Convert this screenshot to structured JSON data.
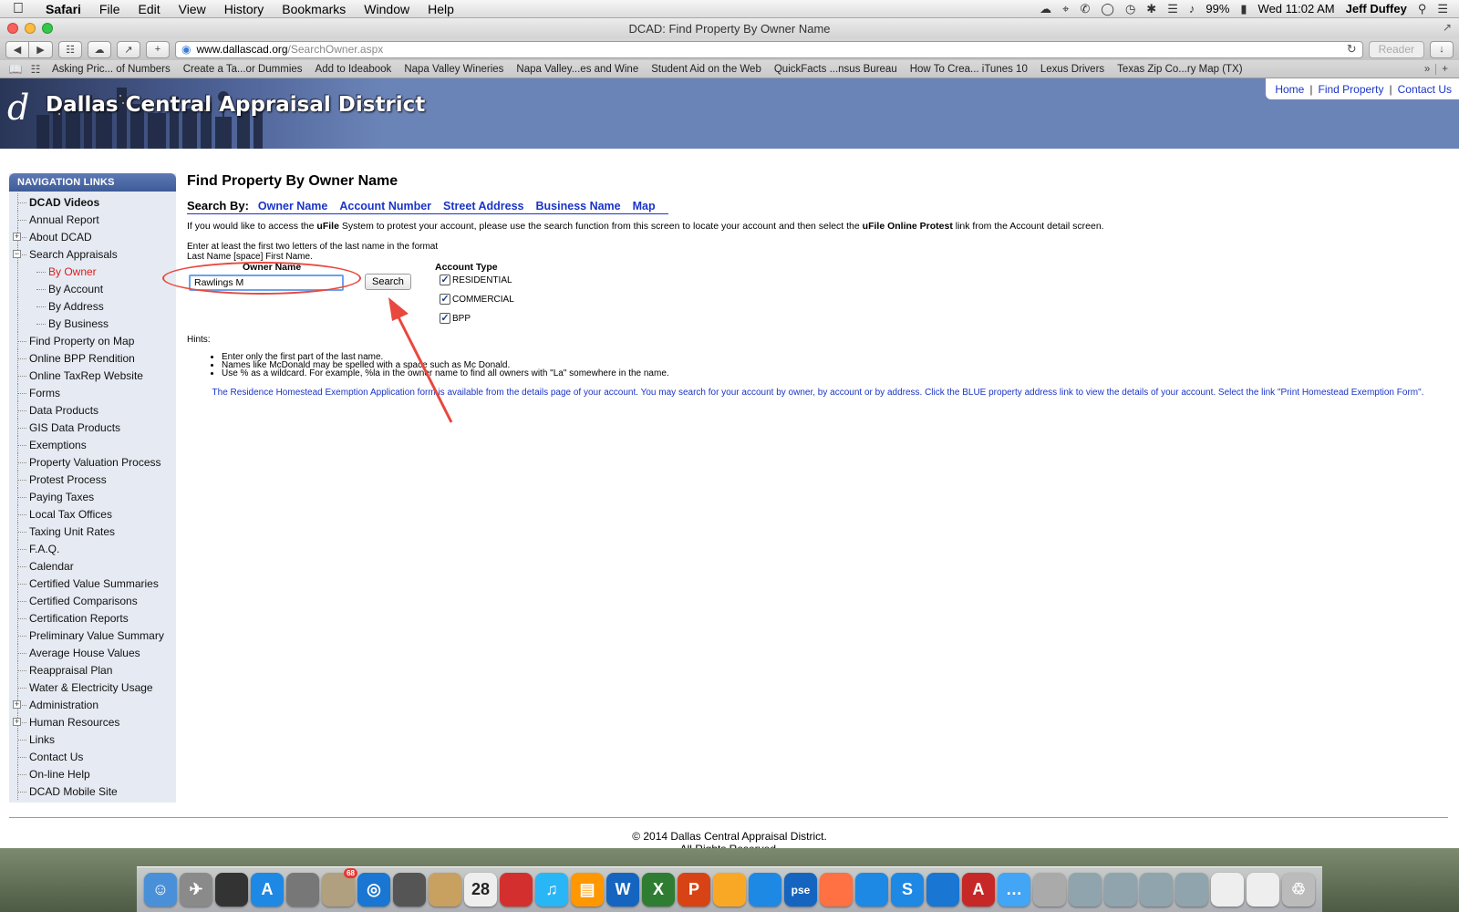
{
  "menubar": {
    "app": "Safari",
    "items": [
      "File",
      "Edit",
      "View",
      "History",
      "Bookmarks",
      "Window",
      "Help"
    ],
    "battery": "99%",
    "clock": "Wed 11:02 AM",
    "user": "Jeff Duffey"
  },
  "window": {
    "title": "DCAD: Find Property By Owner Name",
    "url_host": "www.dallascad.org",
    "url_path": "/SearchOwner.aspx",
    "reader_label": "Reader"
  },
  "bookmarks": [
    "Asking Pric... of Numbers",
    "Create a Ta...or Dummies",
    "Add to Ideabook",
    "Napa Valley Wineries",
    "Napa Valley...es and Wine",
    "Student Aid on the Web",
    "QuickFacts ...nsus Bureau",
    "How To Crea... iTunes 10",
    "Lexus Drivers",
    "Texas Zip Co...ry Map (TX)"
  ],
  "site": {
    "logo_letter": "d",
    "title": "Dallas Central Appraisal District",
    "toplinks": [
      "Home",
      "Find Property",
      "Contact Us"
    ]
  },
  "sidebar": {
    "heading": "NAVIGATION LINKS",
    "items": [
      {
        "label": "DCAD Videos",
        "style": "bold"
      },
      {
        "label": "Annual Report"
      },
      {
        "label": "About DCAD",
        "expander": "+"
      },
      {
        "label": "Search Appraisals",
        "expander": "-"
      },
      {
        "label": "By Owner",
        "style": "sub active"
      },
      {
        "label": "By Account",
        "style": "sub"
      },
      {
        "label": "By Address",
        "style": "sub"
      },
      {
        "label": "By Business",
        "style": "sub"
      },
      {
        "label": "Find Property on Map"
      },
      {
        "label": "Online BPP Rendition"
      },
      {
        "label": "Online TaxRep Website"
      },
      {
        "label": "Forms"
      },
      {
        "label": "Data Products"
      },
      {
        "label": "GIS Data Products"
      },
      {
        "label": "Exemptions"
      },
      {
        "label": "Property Valuation Process"
      },
      {
        "label": "Protest Process"
      },
      {
        "label": "Paying Taxes"
      },
      {
        "label": "Local Tax Offices"
      },
      {
        "label": "Taxing Unit Rates"
      },
      {
        "label": "F.A.Q."
      },
      {
        "label": "Calendar"
      },
      {
        "label": "Certified Value Summaries"
      },
      {
        "label": "Certified Comparisons"
      },
      {
        "label": "Certification Reports"
      },
      {
        "label": "Preliminary Value Summary"
      },
      {
        "label": "Average House Values"
      },
      {
        "label": "Reappraisal Plan"
      },
      {
        "label": "Water & Electricity Usage"
      },
      {
        "label": "Administration",
        "expander": "+"
      },
      {
        "label": "Human Resources",
        "expander": "+"
      },
      {
        "label": "Links"
      },
      {
        "label": "Contact Us"
      },
      {
        "label": "On-line Help"
      },
      {
        "label": "DCAD Mobile Site"
      }
    ]
  },
  "main": {
    "heading": "Find Property By Owner Name",
    "search_by_label": "Search By:",
    "search_by_links": [
      "Owner Name",
      "Account Number",
      "Street Address",
      "Business Name",
      "Map"
    ],
    "ufile_text_1": "If you would like to access the ",
    "ufile_bold_1": "uFile",
    "ufile_text_2": " System to protest your account, please use the search function from this screen to locate your account and then select the ",
    "ufile_bold_2": "uFile Online Protest",
    "ufile_text_3": " link from the Account detail screen.",
    "instruction_line1": "Enter at least the first two letters of the last name in the format",
    "instruction_line2": "Last Name [space] First Name.",
    "owner_name_label": "Owner Name",
    "owner_name_value": "Rawlings M",
    "search_button": "Search",
    "account_type_label": "Account Type",
    "account_types": [
      {
        "label": "RESIDENTIAL",
        "checked": true
      },
      {
        "label": "COMMERCIAL",
        "checked": true
      },
      {
        "label": "BPP",
        "checked": true
      }
    ],
    "hints_label": "Hints:",
    "hints": [
      "Enter only the first part of the last name.",
      "Names like McDonald may be spelled with a space such as Mc Donald.",
      "Use % as a wildcard. For example, %la in the owner name to find all owners with \"La\" somewhere in the name."
    ],
    "homestead_note": "The Residence Homestead Exemption Application form is available from the details page of your account. You may search for your account by owner, by account or by address. Click the BLUE property address link to view the details of your account. Select the link \"Print Homestead Exemption Form\"."
  },
  "footer": {
    "line1": "© 2014 Dallas Central Appraisal District.",
    "line2": "All Rights Reserved."
  },
  "annotation_color": "#e9483e",
  "link_color": "#1a34c8",
  "dock": {
    "calendar_day": "28",
    "mail_badge": "68",
    "icons": [
      "finder-icon",
      "launchpad-icon",
      "dashboard-icon",
      "app-store-icon",
      "system-preferences-icon",
      "mail-icon",
      "safari-icon",
      "facetime-icon",
      "contacts-icon",
      "calendar-icon",
      "wunderlist-icon",
      "itunes-icon",
      "ibooks-icon",
      "word-icon",
      "excel-icon",
      "powerpoint-icon",
      "pages-icon",
      "keynote-icon",
      "photoshop-elements-icon",
      "photo-icon",
      "iphoto-icon",
      "snagit-icon",
      "notes-icon",
      "acrobat-icon",
      "messages-icon",
      "preview-icon",
      "folder-icon",
      "folder-icon",
      "folder-icon",
      "folder-icon",
      "document-icon",
      "calendar-file-icon",
      "trash-icon"
    ]
  }
}
